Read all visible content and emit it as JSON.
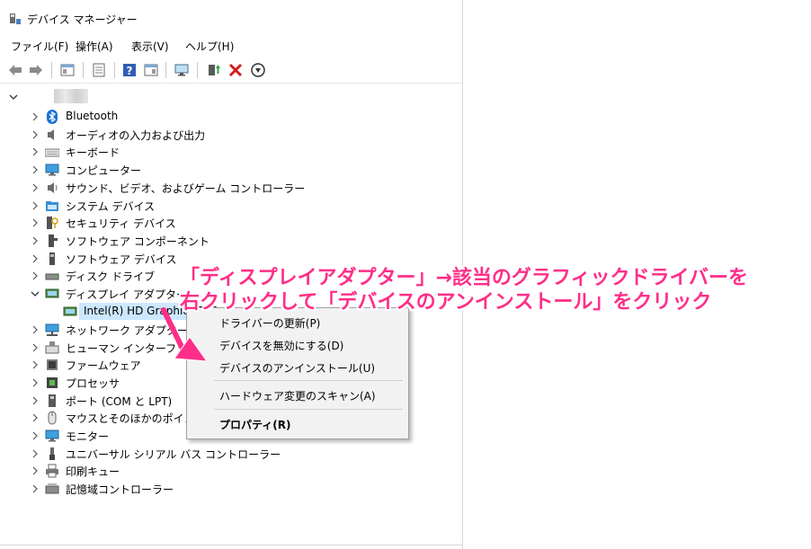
{
  "window": {
    "title": "デバイス マネージャー"
  },
  "menu": [
    "ファイル(F)",
    "操作(A)",
    "表示(V)",
    "ヘルプ(H)"
  ],
  "toolbar": {
    "icons": [
      "back-arrow-icon",
      "forward-arrow-icon",
      "properties-pane-icon",
      "show-hide-console-tree-icon",
      "help-icon",
      "action-pane-icon",
      "monitor-icon",
      "update-driver-icon",
      "uninstall-x-icon",
      "download-circle-icon"
    ]
  },
  "tree": {
    "items": [
      {
        "label": "Bluetooth",
        "icon": "bluetooth-icon"
      },
      {
        "label": "オーディオの入力および出力",
        "icon": "speaker-icon"
      },
      {
        "label": "キーボード",
        "icon": "keyboard-icon"
      },
      {
        "label": "コンピューター",
        "icon": "computer-icon"
      },
      {
        "label": "サウンド、ビデオ、およびゲーム コントローラー",
        "icon": "sound-icon"
      },
      {
        "label": "システム デバイス",
        "icon": "system-folder-icon"
      },
      {
        "label": "セキュリティ デバイス",
        "icon": "security-key-icon"
      },
      {
        "label": "ソフトウェア コンポーネント",
        "icon": "software-component-icon"
      },
      {
        "label": "ソフトウェア デバイス",
        "icon": "software-device-icon"
      },
      {
        "label": "ディスク ドライブ",
        "icon": "disk-drive-icon"
      },
      {
        "label": "ディスプレイ アダプター",
        "icon": "display-adapter-icon"
      },
      {
        "label": "Intel(R) HD Graphics 520",
        "icon": "display-adapter-icon"
      },
      {
        "label": "ネットワーク アダプター",
        "icon": "network-icon"
      },
      {
        "label": "ヒューマン インターフェイス デバイス",
        "icon": "hid-icon"
      },
      {
        "label": "ファームウェア",
        "icon": "firmware-icon"
      },
      {
        "label": "プロセッサ",
        "icon": "processor-icon"
      },
      {
        "label": "ポート (COM と LPT)",
        "icon": "port-icon"
      },
      {
        "label": "マウスとそのほかのポインティング デバイス",
        "icon": "mouse-icon"
      },
      {
        "label": "モニター",
        "icon": "monitor-icon"
      },
      {
        "label": "ユニバーサル シリアル バス コントローラー",
        "icon": "usb-icon"
      },
      {
        "label": "印刷キュー",
        "icon": "printer-icon"
      },
      {
        "label": "記憶域コントローラー",
        "icon": "storage-icon"
      }
    ]
  },
  "context_menu": {
    "items": [
      "ドライバーの更新(P)",
      "デバイスを無効にする(D)",
      "デバイスのアンインストール(U)",
      "ハードウェア変更のスキャン(A)",
      "プロパティ(R)"
    ]
  },
  "annotation": {
    "line1": "「ディスプレイアダプター」→該当のグラフィックドライバーを",
    "line2": "右クリックして「デバイスのアンインストール」をクリック",
    "color": "#ff2e88"
  }
}
